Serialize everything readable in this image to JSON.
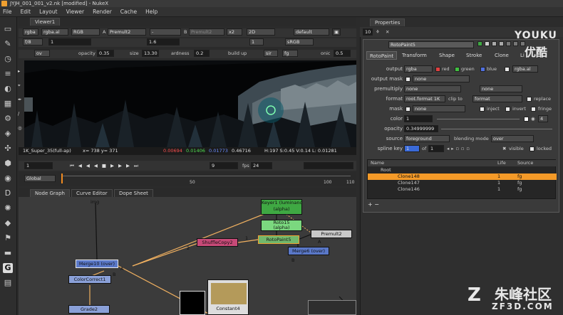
{
  "window": {
    "title": "JYJH_001_001_v2.nk [modified] - NukeX"
  },
  "menu": [
    "File",
    "Edit",
    "Layout",
    "Viewer",
    "Render",
    "Cache",
    "Help"
  ],
  "viewer": {
    "tab_label": "Viewer1",
    "channels": "rgba",
    "layer": "rgba.al",
    "colorspace": "RGB",
    "a_input_label": "A",
    "a_input": "Premult2",
    "b_input_label": "B",
    "b_input": "Premult2",
    "zoom": "x2",
    "view_mode": "2D",
    "lut": "default",
    "fstop": "f/8",
    "gain": "1",
    "gamma": "1.6",
    "proxy": "1",
    "display_lut": "sRGB",
    "overlay": "ov",
    "opacity_label": "opacity",
    "opacity": "0.35",
    "size_label": "size",
    "size": "13.30",
    "hardness_label": "ardness",
    "hardness": "0.2",
    "buildup_label": "build up",
    "brush": "sir",
    "brush_channel": "fg",
    "onion_label": "onic",
    "onion": "0.5",
    "format_label": "1K_Super_35(full-ap)",
    "coords": "x= 738 y= 371",
    "pixel_r": "0.00694",
    "pixel_g": "0.01406",
    "pixel_b": "0.01773",
    "pixel_a": "0.46716",
    "hsvl": "H:197 S:0.45 V:0.14  L: 0.01281"
  },
  "playback": {
    "frame_in": "1",
    "step": "9",
    "fps_label": "fps",
    "fps": "24",
    "range_start": "1",
    "range_end": "110",
    "global": "Global",
    "ticks": [
      "1",
      "50",
      "100",
      "110"
    ],
    "current_frame": "1"
  },
  "nodegraph": {
    "tabs": [
      "Node Graph",
      "Curve Editor",
      "Dope Sheet"
    ],
    "read_label": "img",
    "nodes": {
      "keyer": "Keyer1 (luminance key)",
      "keyer_sub": "(alpha)",
      "roto": "Roto15",
      "roto_sub": "(alpha)",
      "rotopaint": "RotoPaint5",
      "premult": "Premult2",
      "shuffle": "ShuffleCopy2",
      "merge6": "Merge6 (over)",
      "merge10": "Merge10 (over)",
      "colorcorrect": "ColorCorrect1",
      "grade": "Grade2",
      "constant": "Constant4"
    },
    "pipe_labels": [
      "A",
      "B",
      "2",
      "1",
      "A",
      "B"
    ]
  },
  "properties": {
    "title": "Properties",
    "max_panels": "10",
    "node_name": "RotoPaint5",
    "tabs": [
      "RotoPaint",
      "Transform",
      "Shape",
      "Stroke",
      "Clone",
      "Li"
    ],
    "rows": {
      "output_label": "output",
      "output": "rgba",
      "output_checks": [
        "red",
        "green",
        "blue"
      ],
      "output_alpha": "rgba.al",
      "output_mask_label": "output mask",
      "output_mask": "none",
      "premultiply_label": "premultiply",
      "premultiply": "none",
      "premultiply_b": "none",
      "format_label": "format",
      "format": "root.format 1K",
      "clip_to_label": "clip to",
      "clip_to": "format",
      "replace_label": "replace",
      "mask_label": "mask",
      "mask": "none",
      "inject_label": "inject",
      "invert_label": "invert",
      "fringe_label": "fringe",
      "color_label": "color",
      "color": "1",
      "color_channels": "4",
      "opacity_label": "opacity",
      "opacity": "0.34999999",
      "source_label": "source",
      "source": "foreground",
      "blending_label": "blending mode",
      "blending": "over",
      "splinekey_label": "spline key",
      "splinekey": "1",
      "of_label": "of",
      "of": "1",
      "visible_label": "visible",
      "locked_label": "locked"
    },
    "tree": {
      "headers": [
        "Name",
        "Life",
        "Source"
      ],
      "rows": [
        {
          "name": "Root",
          "life": "",
          "source": ""
        },
        {
          "name": "Clone148",
          "life": "1",
          "source": "fg"
        },
        {
          "name": "Clone147",
          "life": "1",
          "source": "fg"
        },
        {
          "name": "Clone146",
          "life": "1",
          "source": "fg"
        }
      ]
    }
  },
  "watermarks": {
    "youku": "YOUKU",
    "youku_cn": "优酷",
    "site_cn": "朱峰社区",
    "site_url": "ZF3D.COM"
  },
  "colors": {
    "accent_orange": "#f08a20",
    "roto_green": "#3fa843",
    "selected_row": "#f49a28",
    "merge_blue": "#5a78c8",
    "shuffle_pink": "#c84a78"
  }
}
